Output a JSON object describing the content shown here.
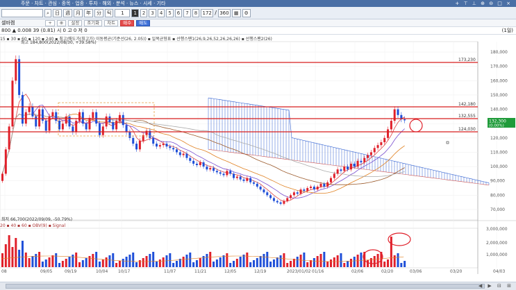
{
  "topbar": {
    "menu": "주문   ·   차트   ·   관심   ·   종목   ·   업종   ·   투자   ·   해외   ·   분석   ·   뉴스   ·   시세   ·   기타",
    "controls": "+ ⊤ ⊥ ⊕ ⊖ □ ×"
  },
  "toolbar1": {
    "stock_name": "",
    "period_buttons": [
      "日",
      "週",
      "月",
      "年",
      "分",
      "틱",
      "1"
    ],
    "interval_buttons": [
      "1",
      "2",
      "3",
      "4",
      "5",
      "6",
      "7",
      "8"
    ],
    "count_value": "172",
    "count_total": "360"
  },
  "toolbar2": {
    "ticker": "셀바켐",
    "buttons": [
      "설정",
      "조기화",
      "차트",
      "매수",
      "매도"
    ]
  },
  "toolbar3": {
    "quote": "800  ▲ 0.008  39  (0.81)  시 0  고 0  저 0",
    "chart_period": "(1일)"
  },
  "legend_main": "15 ▪ 30 ▪ 60 ▪ 120 ▪ 240 ▪ 최고/매도가(최고가) 이동평균(기준선(26, 2.05)) ▪ 일목균형표 ▪ 선행스팬1(26,9,26,52,26,26,26) ▪ 선행스팬2(26)",
  "legend_high": "최고 184,800(2022/08/30, +39.58%)",
  "legend_low": "최저 66,700(2022/09/09, -50.79%)",
  "volume_legend": "20 ▪ 40 ▪ 60 ▪ OBV(9) ▪ Signal",
  "price_axis": [
    "180,000",
    "170,000",
    "160,000",
    "150,000",
    "140,000",
    "130,000",
    "120,000",
    "110,000",
    "100,000",
    "90,000",
    "80,000",
    "70,000"
  ],
  "volume_axis": [
    "3,000,000",
    "2,000,000",
    "1,000,000"
  ],
  "x_axis": [
    "08",
    "09/05",
    "09/19",
    "10/04",
    "10/17",
    "11/07",
    "11/21",
    "12/05",
    "12/19",
    "2023/01/02",
    "01/16",
    "02/06",
    "02/20",
    "03/06",
    "03/20",
    "04/03"
  ],
  "levels": [
    {
      "label": "173,230",
      "color": "#d61f1f"
    },
    {
      "label": "142,180",
      "color": "#d61f1f"
    },
    {
      "label": "132,555",
      "color": "#d61f1f"
    },
    {
      "label": "124,030",
      "color": "#d61f1f"
    }
  ],
  "current_price": {
    "price": "132,300",
    "change": "(0.00%)",
    "color": "#1f9b3a"
  },
  "colors": {
    "up": "#e0202a",
    "down": "#1f4fd8",
    "cloud_blue": "#2f5fd0",
    "cloud_red": "#e55",
    "accent": "#4a6fa5"
  },
  "scrollbar": {
    "controls": "◀ ▶ ⊟ ⊞"
  }
}
